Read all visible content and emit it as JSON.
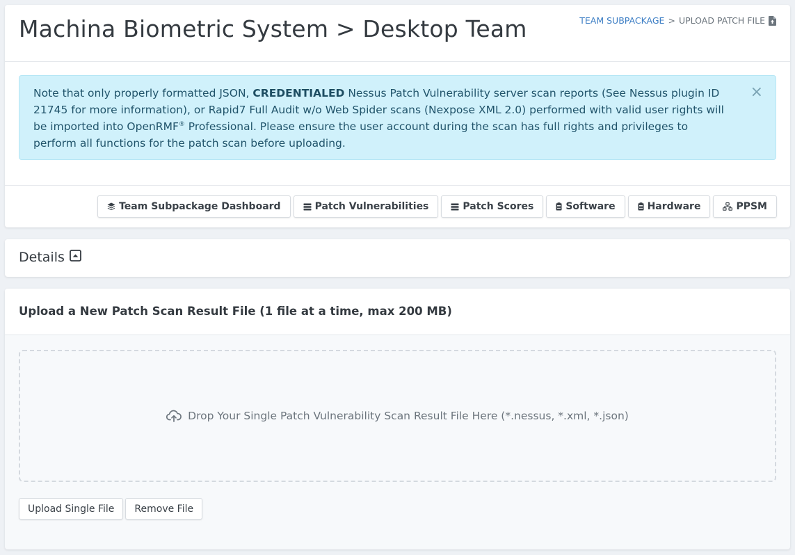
{
  "header": {
    "title": "Machina Biometric System > Desktop Team",
    "breadcrumb": {
      "link_label": "TEAM SUBPACKAGE",
      "separator": ">",
      "current_label": "UPLOAD PATCH FILE",
      "icon": "file-upload-icon"
    }
  },
  "alert": {
    "text_before": "Note that only properly formatted JSON, ",
    "emphasis": "CREDENTIALED",
    "text_after": " Nessus Patch Vulnerability server scan reports (See Nessus plugin ID 21745 for more information), or Rapid7 Full Audit w/o Web Spider scans (Nexpose XML 2.0) performed with valid user rights will be imported into OpenRMF",
    "trademark": "®",
    "text_end": " Professional. Please ensure the user account during the scan has full rights and privileges to perform all functions for the patch scan before uploading.",
    "close_label": "×"
  },
  "tabs": [
    {
      "label": "Team Subpackage Dashboard",
      "icon": "layers-icon"
    },
    {
      "label": "Patch Vulnerabilities",
      "icon": "server-icon"
    },
    {
      "label": "Patch Scores",
      "icon": "server-icon"
    },
    {
      "label": "Software",
      "icon": "clipboard-icon"
    },
    {
      "label": "Hardware",
      "icon": "clipboard-icon"
    },
    {
      "label": "PPSM",
      "icon": "network-icon"
    }
  ],
  "details": {
    "title": "Details",
    "toggle_icon": "caret-square-up-icon"
  },
  "upload": {
    "title": "Upload a New Patch Scan Result File (1 file at a time, max 200 MB)",
    "dropzone_text": "Drop Your Single Patch Vulnerability Scan Result File Here (*.nessus, *.xml, *.json)",
    "dropzone_icon": "cloud-upload-icon",
    "upload_button": "Upload Single File",
    "remove_button": "Remove File"
  },
  "colors": {
    "page_background": "#eef1f5",
    "link": "#3b7dc4",
    "alert_background": "#d0f1fb",
    "alert_text": "#21546b"
  }
}
